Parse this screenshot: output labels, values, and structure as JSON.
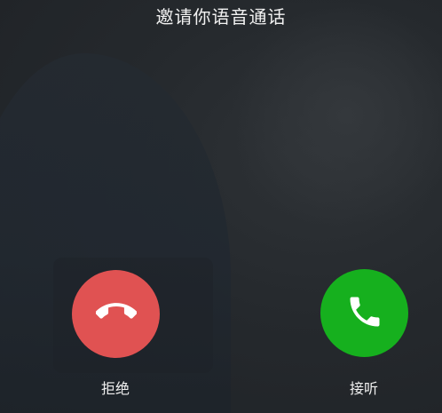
{
  "call": {
    "title": "邀请你语音通话"
  },
  "actions": {
    "decline_label": "拒绝",
    "accept_label": "接听",
    "decline_icon": "hang-up-icon",
    "accept_icon": "phone-icon"
  },
  "colors": {
    "decline": "#e05252",
    "accept": "#16b01e",
    "text": "#f2f2f2"
  }
}
